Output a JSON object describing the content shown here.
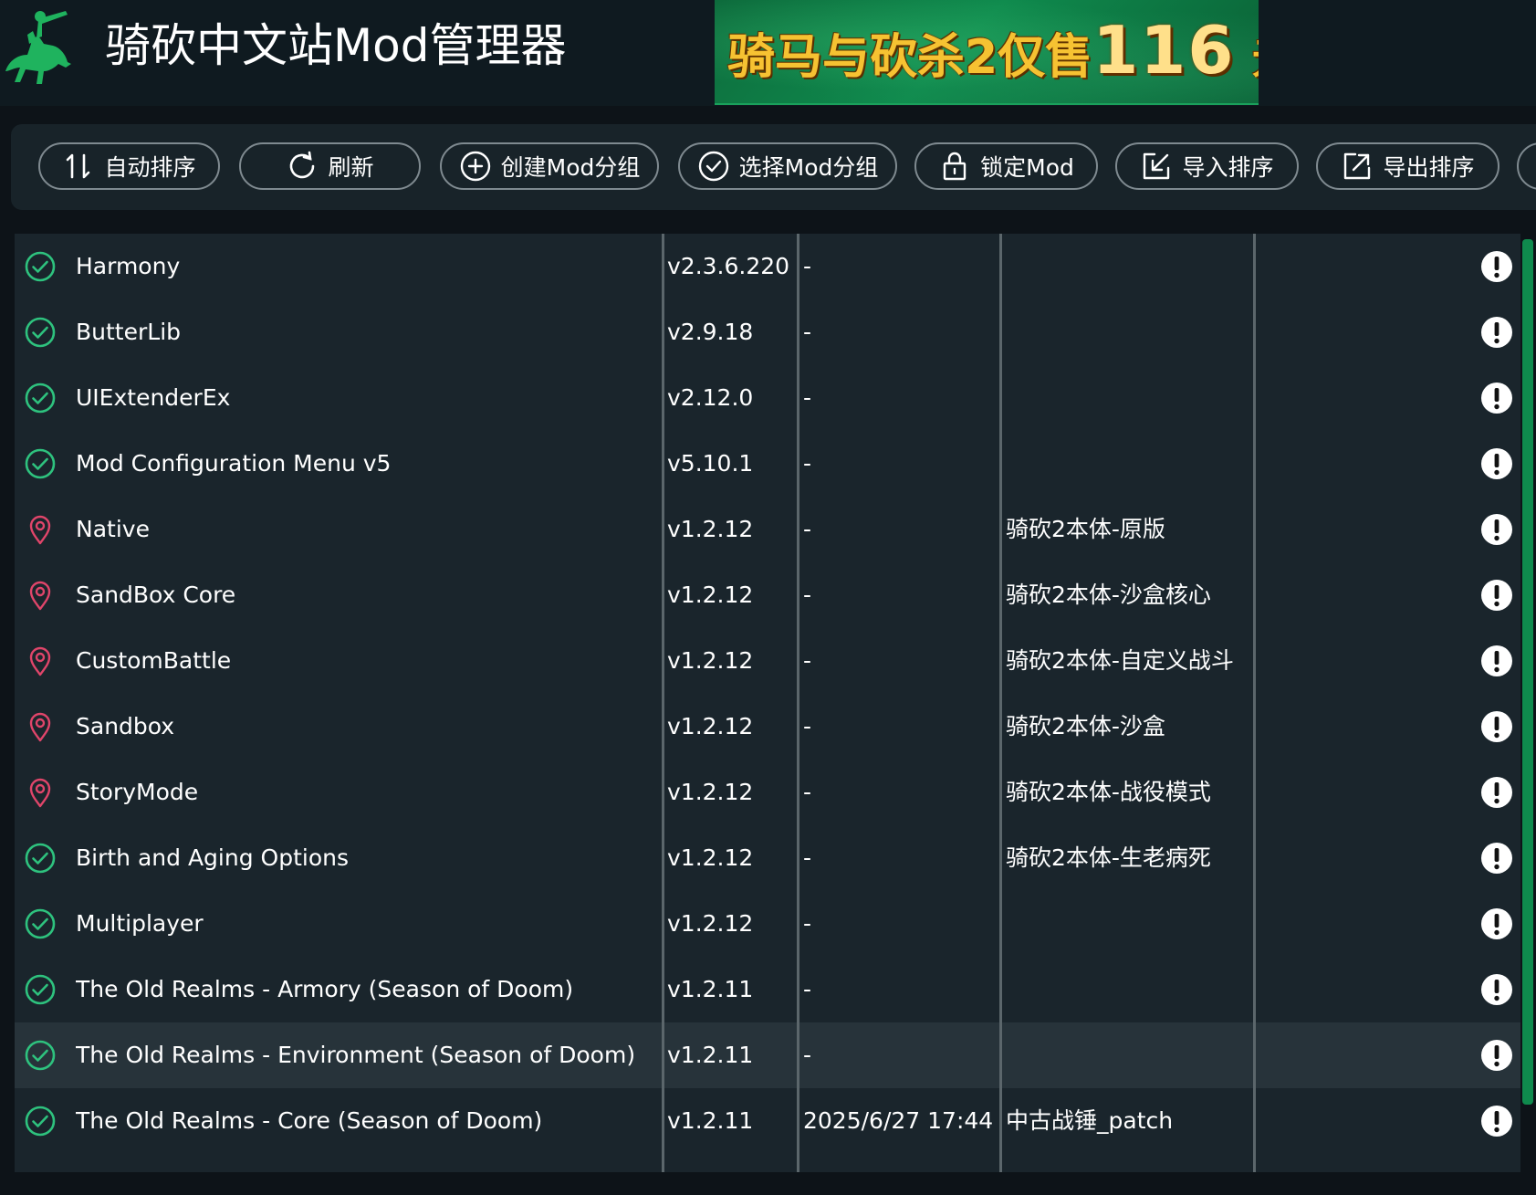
{
  "app": {
    "title": "骑砍中文站Mod管理器",
    "logo_icon": "knight-on-horse-icon"
  },
  "banner": {
    "text": "骑马与砍杀2仅售",
    "price": "116",
    "unit": "元"
  },
  "toolbar": {
    "buttons": [
      {
        "label": "自动排序",
        "icon": "sort-icon"
      },
      {
        "label": "刷新",
        "icon": "refresh-icon"
      },
      {
        "label": "创建Mod分组",
        "icon": "plus-circle-icon"
      },
      {
        "label": "选择Mod分组",
        "icon": "check-circle-icon"
      },
      {
        "label": "锁定Mod",
        "icon": "lock-icon"
      },
      {
        "label": "导入排序",
        "icon": "import-icon"
      },
      {
        "label": "导出排序",
        "icon": "export-icon"
      }
    ]
  },
  "mods": [
    {
      "status": "check",
      "name": "Harmony",
      "version": "v2.3.6.220",
      "date": "-",
      "tag": ""
    },
    {
      "status": "check",
      "name": "ButterLib",
      "version": "v2.9.18",
      "date": "-",
      "tag": ""
    },
    {
      "status": "check",
      "name": "UIExtenderEx",
      "version": "v2.12.0",
      "date": "-",
      "tag": ""
    },
    {
      "status": "check",
      "name": "Mod Configuration Menu v5",
      "version": "v5.10.1",
      "date": "-",
      "tag": ""
    },
    {
      "status": "pin",
      "name": "Native",
      "version": "v1.2.12",
      "date": "-",
      "tag": "骑砍2本体-原版"
    },
    {
      "status": "pin",
      "name": "SandBox Core",
      "version": "v1.2.12",
      "date": "-",
      "tag": "骑砍2本体-沙盒核心"
    },
    {
      "status": "pin",
      "name": "CustomBattle",
      "version": "v1.2.12",
      "date": "-",
      "tag": "骑砍2本体-自定义战斗"
    },
    {
      "status": "pin",
      "name": "Sandbox",
      "version": "v1.2.12",
      "date": "-",
      "tag": "骑砍2本体-沙盒"
    },
    {
      "status": "pin",
      "name": "StoryMode",
      "version": "v1.2.12",
      "date": "-",
      "tag": "骑砍2本体-战役模式"
    },
    {
      "status": "check",
      "name": "Birth and Aging Options",
      "version": "v1.2.12",
      "date": "-",
      "tag": "骑砍2本体-生老病死"
    },
    {
      "status": "check",
      "name": "Multiplayer",
      "version": "v1.2.12",
      "date": "-",
      "tag": ""
    },
    {
      "status": "check",
      "name": "The Old Realms - Armory (Season of Doom)",
      "version": "v1.2.11",
      "date": "-",
      "tag": ""
    },
    {
      "status": "check",
      "name": "The Old Realms - Environment (Season of Doom)",
      "version": "v1.2.11",
      "date": "-",
      "tag": "",
      "highlighted": true
    },
    {
      "status": "check",
      "name": "The Old Realms - Core (Season of Doom)",
      "version": "v1.2.11",
      "date": "2025/6/27 17:44",
      "tag": "中古战锤_patch"
    }
  ],
  "colors": {
    "check": "#2ec27e",
    "pin": "#e0456a",
    "accent": "#0f8a4d"
  }
}
